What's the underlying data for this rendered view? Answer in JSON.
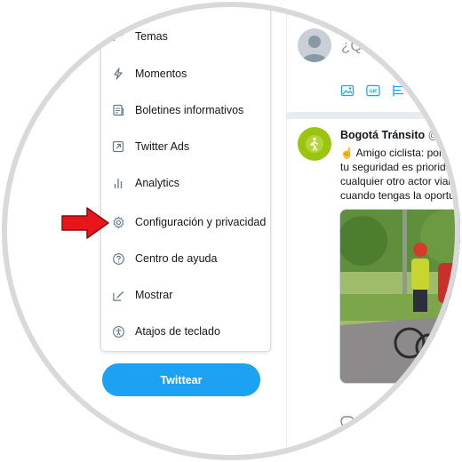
{
  "menu": {
    "items": [
      {
        "label": "Temas",
        "icon": "topics-icon"
      },
      {
        "label": "Momentos",
        "icon": "moments-bolt-icon"
      },
      {
        "label": "Boletines informativos",
        "icon": "newsletter-icon"
      },
      {
        "label": "Twitter Ads",
        "icon": "ads-external-icon"
      },
      {
        "label": "Analytics",
        "icon": "analytics-bars-icon"
      },
      {
        "label": "Configuración y privacidad",
        "icon": "gear-icon"
      },
      {
        "label": "Centro de ayuda",
        "icon": "help-question-icon"
      },
      {
        "label": "Mostrar",
        "icon": "display-pencil-icon"
      },
      {
        "label": "Atajos de teclado",
        "icon": "accessibility-icon"
      }
    ]
  },
  "tweet_button": {
    "label": "Twittear"
  },
  "compose": {
    "placeholder": "¿Qu"
  },
  "tweet": {
    "name": "Bogotá Tránsito",
    "handle": "@B",
    "lines": [
      "☝ Amigo ciclista: por",
      "tu seguridad es priorida",
      "cualquier otro actor vial,",
      "cuando tengas la oportu"
    ]
  },
  "colors": {
    "accent": "#1da1f2",
    "arrow": "#e8151b",
    "icon": "#657786",
    "avatar_green": "#9bc411"
  }
}
